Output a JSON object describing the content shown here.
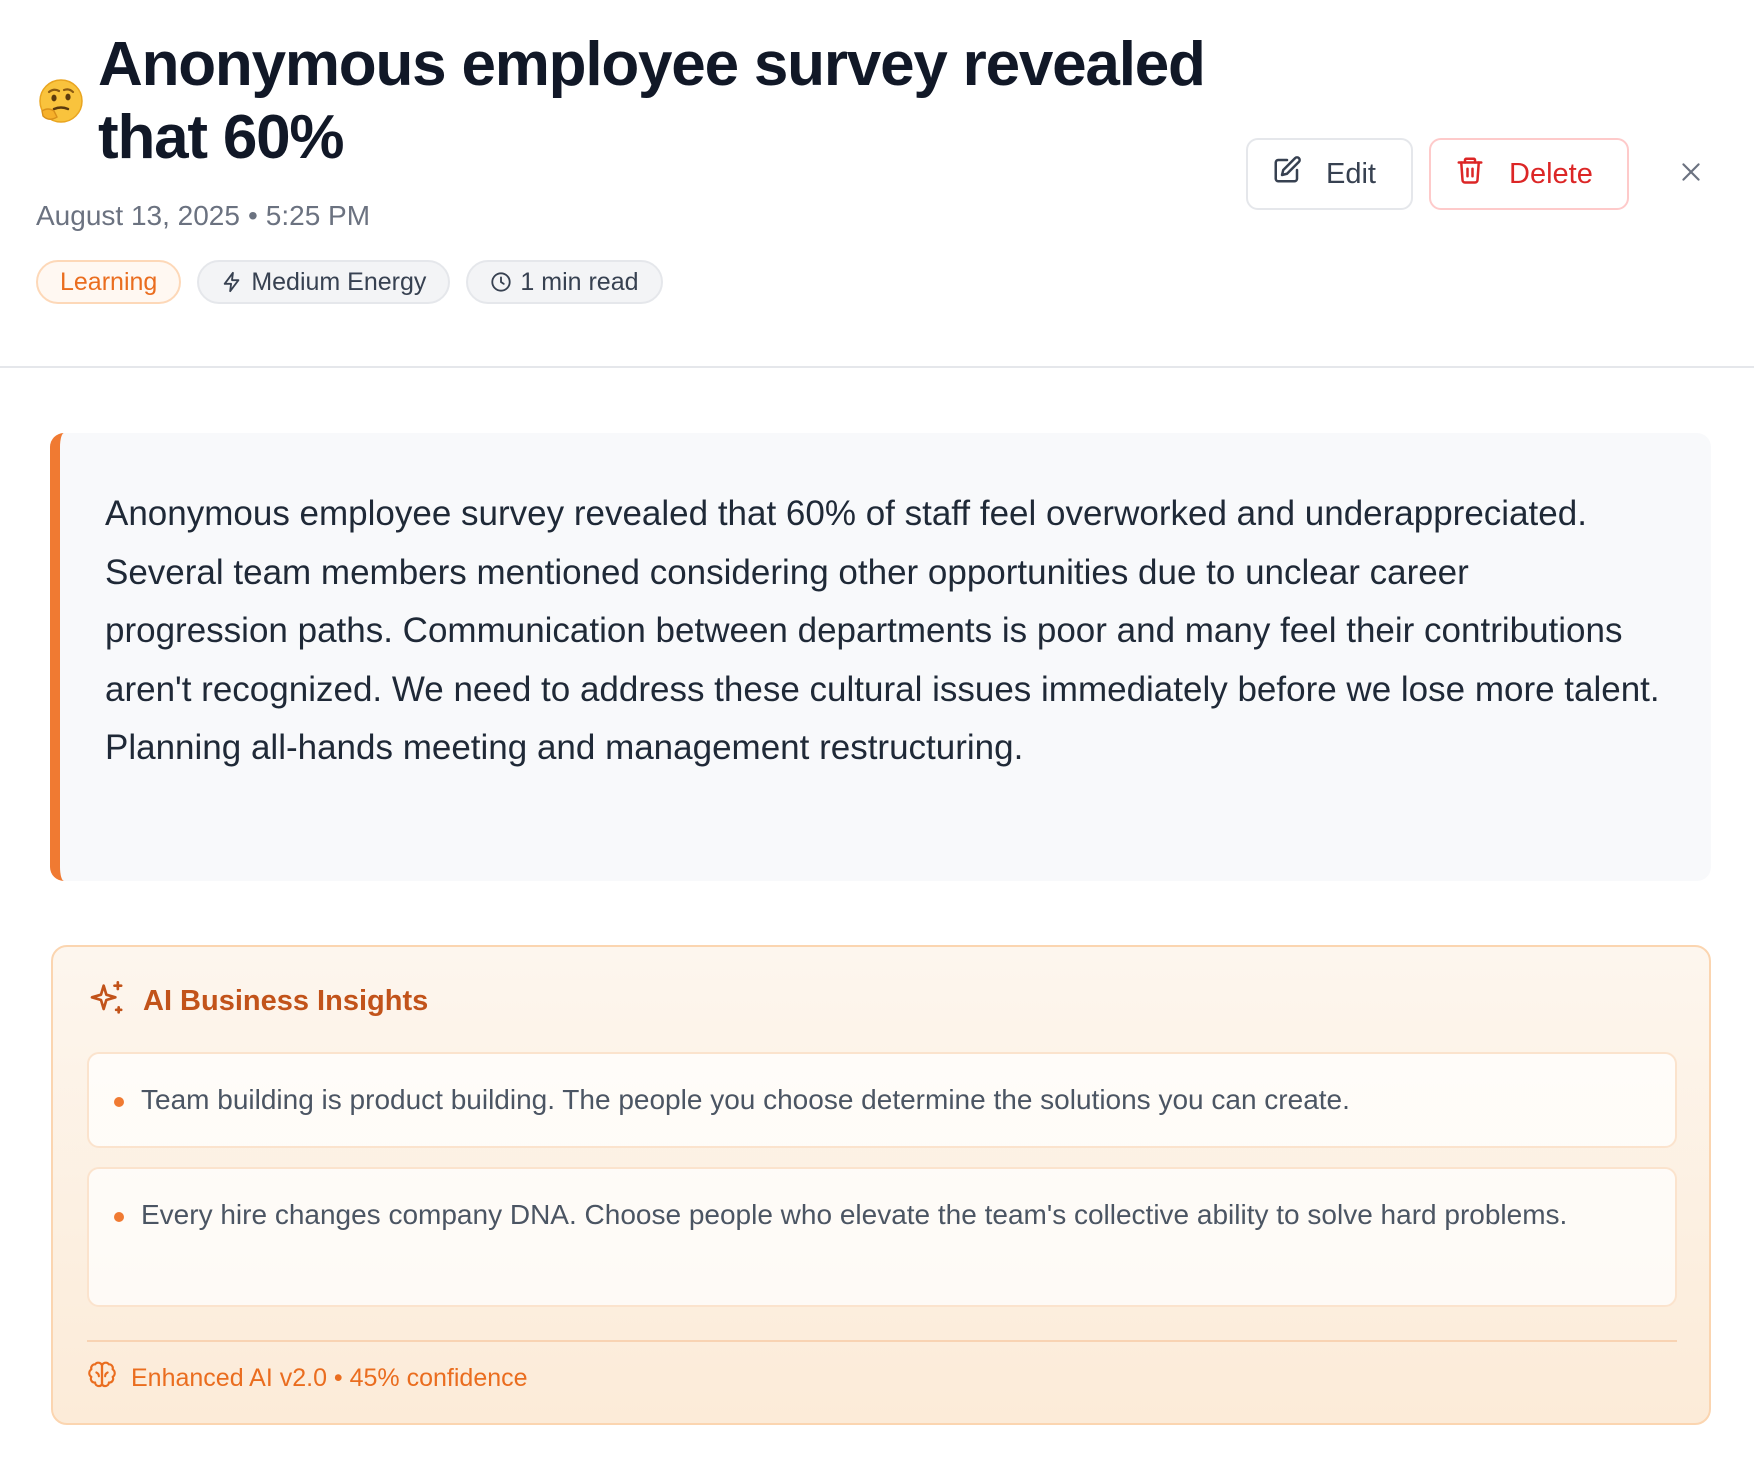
{
  "header": {
    "emoji": "🤔",
    "title": "Anonymous employee survey revealed that 60%",
    "date": "August 13, 2025",
    "separator": "•",
    "time": "5:25 PM"
  },
  "tags": {
    "category": "Learning",
    "energy": "Medium Energy",
    "read_time": "1 min read"
  },
  "actions": {
    "edit_label": "Edit",
    "delete_label": "Delete"
  },
  "note": {
    "body": "Anonymous employee survey revealed that 60% of staff feel overworked and underappreciated. Several team members mentioned considering other opportunities due to unclear career progression paths. Communication between departments is poor and many feel their contributions aren't recognized. We need to address these cultural issues immediately before we lose more talent. Planning all-hands meeting and management restructuring."
  },
  "insights": {
    "title": "AI Business Insights",
    "items": [
      {
        "text": "Team building is product building. The people you choose determine the solutions you can create."
      },
      {
        "text": "Every hire changes company DNA. Choose people who elevate the team's collective ability to solve hard problems."
      }
    ],
    "footer": "Enhanced AI v2.0 • 45% confidence"
  },
  "colors": {
    "accent_orange": "#f07a32",
    "delete_red": "#dc2626",
    "title_text": "#111827",
    "muted_text": "#6b7280"
  },
  "icons": {
    "energy": "lightning-icon",
    "read_time": "clock-icon",
    "edit": "edit-square-icon",
    "delete": "trash-icon",
    "close": "close-icon",
    "insights": "sparkles-icon",
    "footer": "brain-icon"
  }
}
